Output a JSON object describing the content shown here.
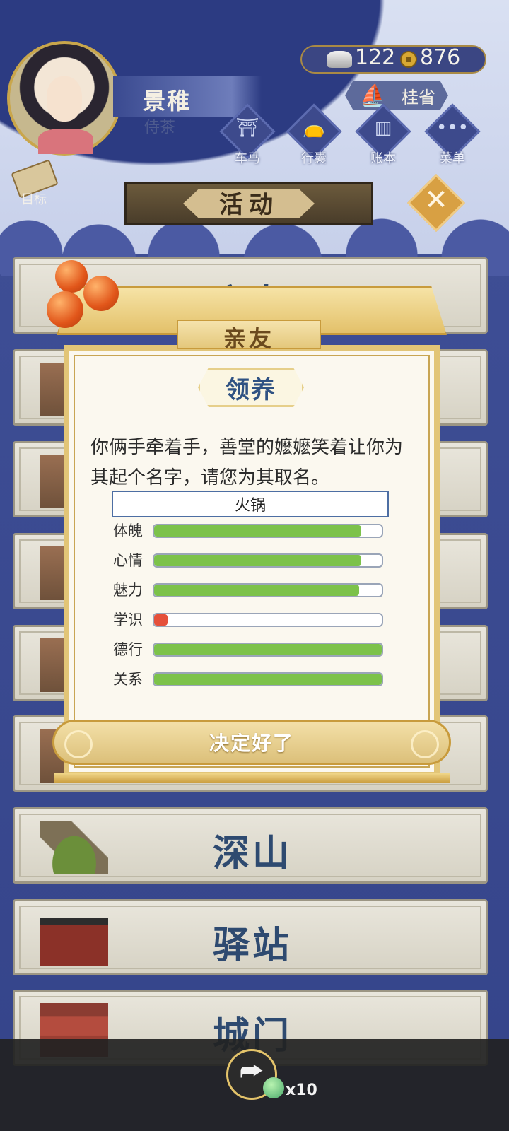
{
  "header": {
    "character_name": "景稚",
    "character_role": "侍茶",
    "silver": "122",
    "gold": "876",
    "location": "桂省",
    "nav": [
      "车马",
      "行囊",
      "账本",
      "菜单"
    ],
    "goal_label": "目标"
  },
  "activity": {
    "title": "活动",
    "close_glyph": "✕"
  },
  "cards": [
    "亲友",
    "深山",
    "驿站",
    "城门"
  ],
  "dialog": {
    "tab_title": "亲友",
    "subtitle": "领养",
    "message": "你俩手牵着手，善堂的嬷嬷笑着让你为其起个名字，请您为其取名。",
    "name_value": "火锅",
    "stats": [
      {
        "label": "体魄",
        "value": 0.91,
        "color": "#7cc24a"
      },
      {
        "label": "心情",
        "value": 0.91,
        "color": "#7cc24a"
      },
      {
        "label": "魅力",
        "value": 0.9,
        "color": "#7cc24a"
      },
      {
        "label": "学识",
        "value": 0.06,
        "color": "#e5503a"
      },
      {
        "label": "德行",
        "value": 1.0,
        "color": "#7cc24a"
      },
      {
        "label": "关系",
        "value": 1.0,
        "color": "#7cc24a"
      }
    ],
    "confirm_label": "决定好了"
  },
  "bottom": {
    "share_glyph": "⮫",
    "token_count": "x10"
  },
  "colors": {
    "accent_gold": "#c89b3c",
    "title_blue": "#2f5283",
    "bar_green": "#7cc24a",
    "bar_red": "#e5503a"
  }
}
